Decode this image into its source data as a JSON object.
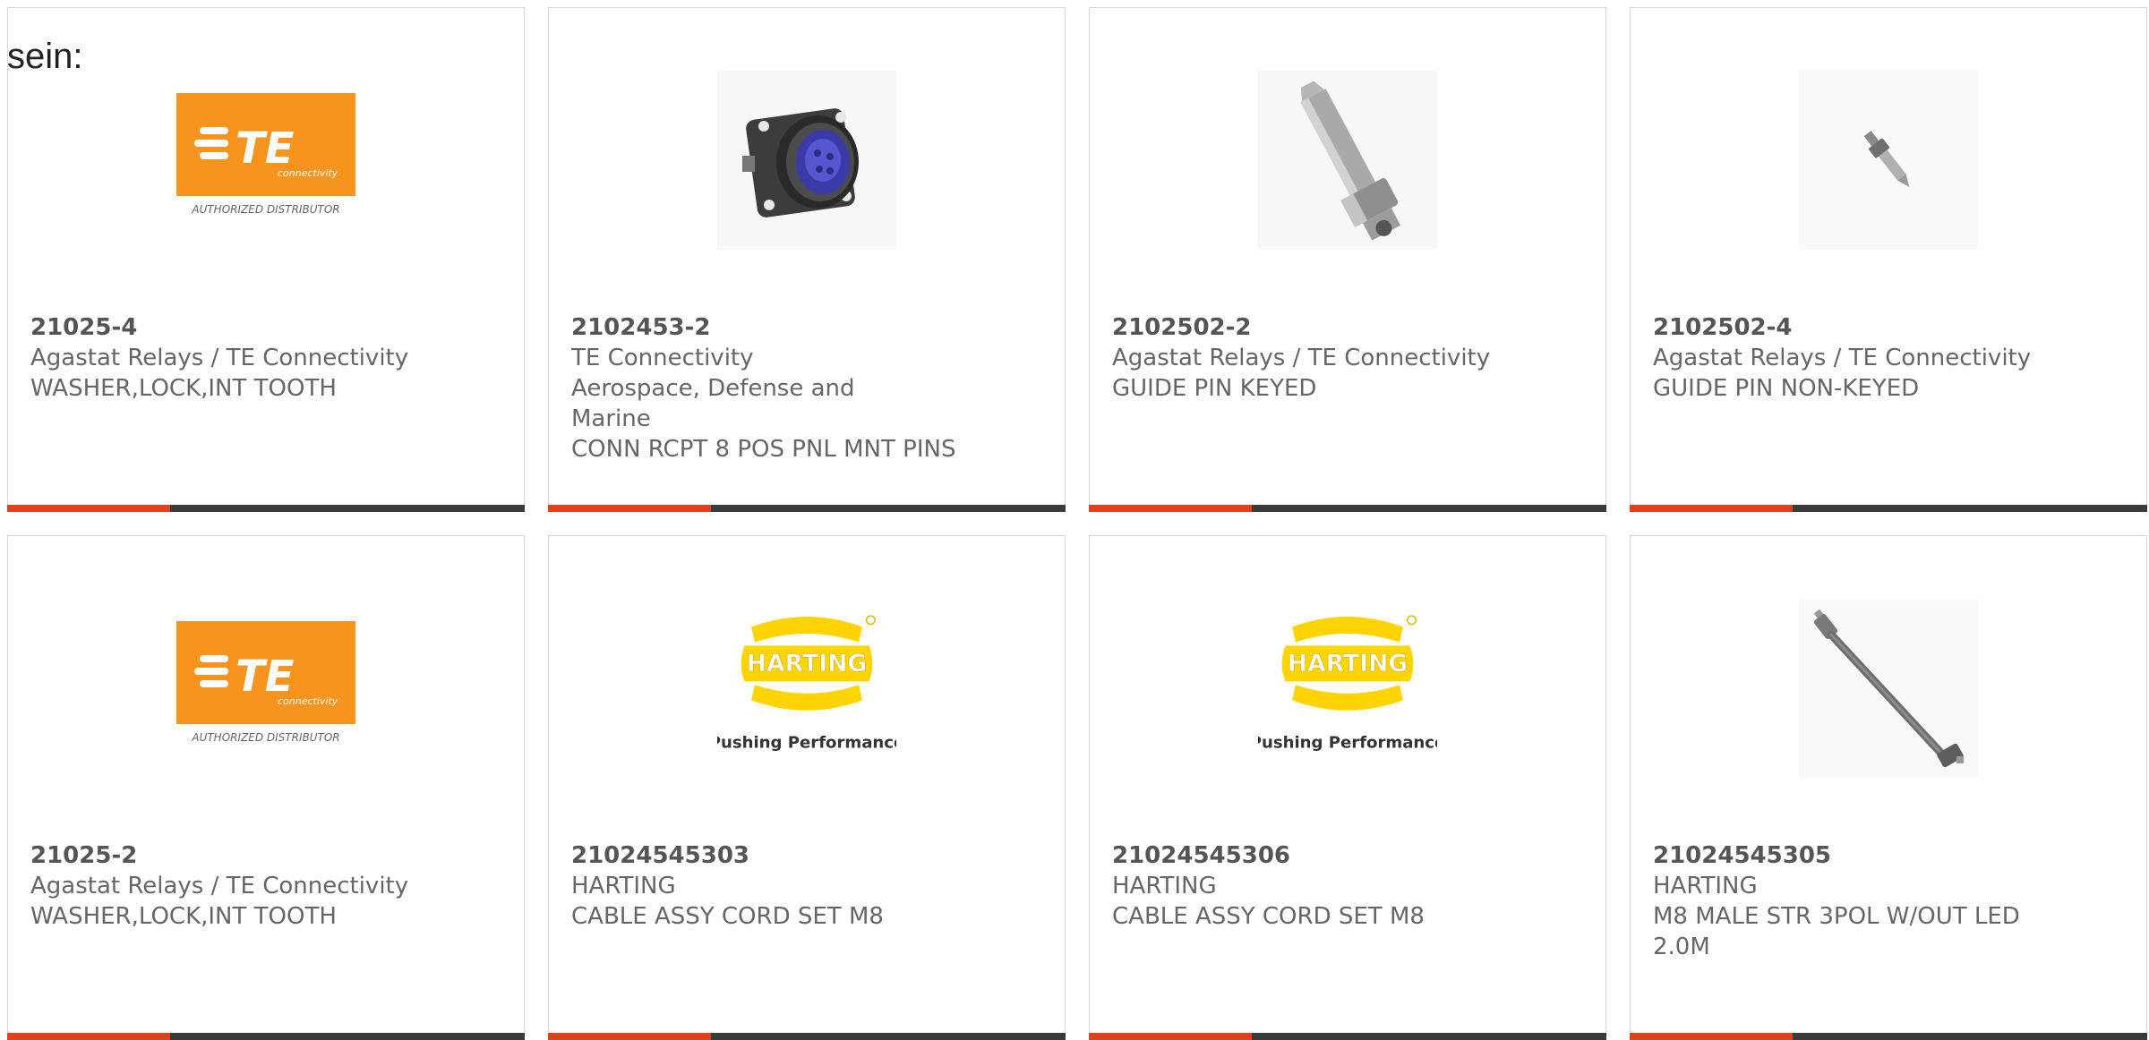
{
  "intro_text": "sein:",
  "colors": {
    "accent_bar": "#e0401c",
    "dark_bar": "#3a3a3a",
    "te_orange": "#f7941d",
    "harting_yellow": "#ffd400"
  },
  "products": [
    {
      "part_number": "21025-4",
      "manufacturer": "Agastat Relays / TE Connectivity",
      "description": "WASHER,LOCK,INT TOOTH",
      "image": "te-connectivity-logo",
      "logo_text": "TE",
      "logo_subtext": "connectivity",
      "logo_caption": "AUTHORIZED DISTRIBUTOR"
    },
    {
      "part_number": "2102453-2",
      "manufacturer": "TE Connectivity Aerospace, Defense and Marine",
      "description": "CONN RCPT 8 POS PNL MNT PINS",
      "image": "circular-connector-icon"
    },
    {
      "part_number": "2102502-2",
      "manufacturer": "Agastat Relays / TE Connectivity",
      "description": "GUIDE PIN KEYED",
      "image": "guide-pin-keyed-icon"
    },
    {
      "part_number": "2102502-4",
      "manufacturer": "Agastat Relays / TE Connectivity",
      "description": "GUIDE PIN NON-KEYED",
      "image": "guide-pin-small-icon"
    },
    {
      "part_number": "21025-2",
      "manufacturer": "Agastat Relays / TE Connectivity",
      "description": "WASHER,LOCK,INT TOOTH",
      "image": "te-connectivity-logo",
      "logo_text": "TE",
      "logo_subtext": "connectivity",
      "logo_caption": "AUTHORIZED DISTRIBUTOR"
    },
    {
      "part_number": "21024545303",
      "manufacturer": "HARTING",
      "description": "CABLE ASSY CORD SET M8",
      "image": "harting-logo",
      "logo_text": "HARTING",
      "logo_caption": "Pushing Performance"
    },
    {
      "part_number": "21024545306",
      "manufacturer": "HARTING",
      "description": "CABLE ASSY CORD SET M8",
      "image": "harting-logo",
      "logo_text": "HARTING",
      "logo_caption": "Pushing Performance"
    },
    {
      "part_number": "21024545305",
      "manufacturer": "HARTING",
      "description": "M8 MALE STR 3POL W/OUT LED 2.0M",
      "image": "m8-cable-icon"
    }
  ]
}
